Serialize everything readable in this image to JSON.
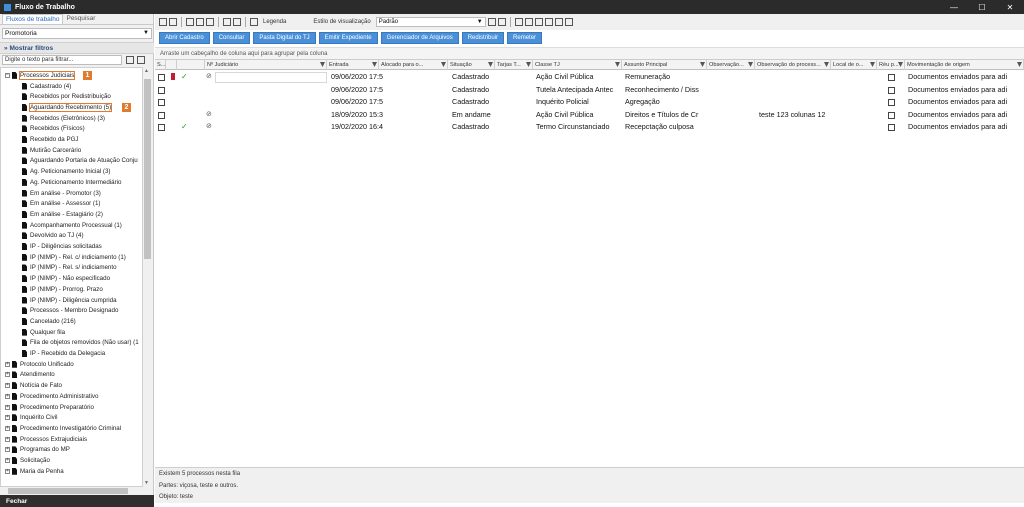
{
  "window": {
    "title": "Fluxo de Trabalho"
  },
  "left": {
    "tabs": [
      "Fluxos de trabalho",
      "Pesquisar"
    ],
    "combo_value": "Promotoria",
    "filter_toggle": "Mostrar filtros",
    "filter_placeholder": "Digite o texto para filtrar...",
    "tree": [
      {
        "label": "Processos Judiciais",
        "level": 1,
        "expanded": true,
        "highlight": 1
      },
      {
        "label": "Cadastrado (4)",
        "level": 2
      },
      {
        "label": "Recebidos por Redistribuição",
        "level": 2
      },
      {
        "label": "Aguardando Recebimento (5)",
        "level": 2,
        "highlight": 2
      },
      {
        "label": "Recebidos (Eletrônicos) (3)",
        "level": 2
      },
      {
        "label": "Recebidos (Físicos)",
        "level": 2
      },
      {
        "label": "Recebido da PGJ",
        "level": 2
      },
      {
        "label": "Mutirão Carcerário",
        "level": 2
      },
      {
        "label": "Aguardando Portaria de Atuação Conju",
        "level": 2
      },
      {
        "label": "Ag. Peticionamento Inicial (3)",
        "level": 2
      },
      {
        "label": "Ag. Peticionamento Intermediário",
        "level": 2
      },
      {
        "label": "Em análise - Promotor (3)",
        "level": 2
      },
      {
        "label": "Em análise - Assessor (1)",
        "level": 2
      },
      {
        "label": "Em análise - Estagiário (2)",
        "level": 2
      },
      {
        "label": "Acompanhamento Processual (1)",
        "level": 2
      },
      {
        "label": "Devolvido ao TJ (4)",
        "level": 2
      },
      {
        "label": "IP - Diligências solicitadas",
        "level": 2
      },
      {
        "label": "IP (NIMP) - Rel. c/ indiciamento (1)",
        "level": 2
      },
      {
        "label": "IP (NIMP) - Rel. s/ indiciamento",
        "level": 2
      },
      {
        "label": "IP (NIMP) - Não especificado",
        "level": 2
      },
      {
        "label": "IP (NIMP) - Prorrog. Prazo",
        "level": 2
      },
      {
        "label": "IP (NIMP) - Diligência cumprida",
        "level": 2
      },
      {
        "label": "Processos - Membro Designado",
        "level": 2
      },
      {
        "label": "Cancelado (216)",
        "level": 2
      },
      {
        "label": "Qualquer fila",
        "level": 2
      },
      {
        "label": "Fila de objetos removidos (Não usar) (1",
        "level": 2
      },
      {
        "label": "IP - Recebido da Delegacia",
        "level": 2
      },
      {
        "label": "Protocolo Unificado",
        "level": 1
      },
      {
        "label": "Atendimento",
        "level": 1
      },
      {
        "label": "Notícia de Fato",
        "level": 1
      },
      {
        "label": "Procedimento Administrativo",
        "level": 1
      },
      {
        "label": "Procedimento Preparatório",
        "level": 1
      },
      {
        "label": "Inquérito Civil",
        "level": 1
      },
      {
        "label": "Procedimento Investigatório Criminal",
        "level": 1
      },
      {
        "label": "Processos Extrajudiciais",
        "level": 1
      },
      {
        "label": "Programas do MP",
        "level": 1
      },
      {
        "label": "Solicitação",
        "level": 1
      },
      {
        "label": "Maria da Penha",
        "level": 1
      }
    ],
    "badges": [
      "1",
      "2"
    ],
    "close_label": "Fechar"
  },
  "toolbar": {
    "legend_label": "Legenda",
    "view_style_label": "Estilo de visualização",
    "view_style_value": "Padrão",
    "buttons": [
      "Abrir Cadastro",
      "Consultar",
      "Pasta Digital do TJ",
      "Emitir Expediente",
      "Gerenciador de Arquivos",
      "Redistribuir",
      "Remeter"
    ]
  },
  "grid": {
    "group_hint": "Arraste um cabeçalho de coluna aqui para agrupar pela coluna",
    "columns": [
      "S...",
      "",
      "",
      "Nº Judiciário",
      "Entrada",
      "Alocado para o...",
      "Situação",
      "Tarjas T...",
      "Classe TJ",
      "Assunto Principal",
      "Observação...",
      "Observação do process...",
      "Local de o...",
      "Réu p...",
      "Movimentação de origem"
    ],
    "rows": [
      {
        "flag": true,
        "check": true,
        "clip": true,
        "entrada": "09/06/2020 17:5",
        "situacao": "Cadastrado",
        "classe": "Ação Civil Pública",
        "assunto": "Remuneração",
        "obs_proc": "",
        "movimentacao": "Documentos enviados para adi"
      },
      {
        "flag": false,
        "check": false,
        "clip": false,
        "entrada": "09/06/2020 17:5",
        "situacao": "Cadastrado",
        "classe": "Tutela Antecipada Antec",
        "assunto": "Reconhecimento / Diss",
        "obs_proc": "",
        "movimentacao": "Documentos enviados para adi"
      },
      {
        "flag": false,
        "check": false,
        "clip": false,
        "entrada": "09/06/2020 17:5",
        "situacao": "Cadastrado",
        "classe": "Inquérito Policial",
        "assunto": "Agregação",
        "obs_proc": "",
        "movimentacao": "Documentos enviados para adi"
      },
      {
        "flag": false,
        "check": false,
        "clip": true,
        "entrada": "18/09/2020 15:3",
        "situacao": "Em andame",
        "classe": "Ação Civil Pública",
        "assunto": "Direitos e Títulos de Cr",
        "obs_proc": "teste 123  colunas 12",
        "movimentacao": "Documentos enviados para adi"
      },
      {
        "flag": false,
        "check": true,
        "clip": true,
        "entrada": "19/02/2020 16:4",
        "situacao": "Cadastrado",
        "classe": "Termo Circunstanciado",
        "assunto": "Recepctação culposa",
        "obs_proc": "",
        "movimentacao": "Documentos enviados para adi"
      }
    ]
  },
  "status": {
    "count": "Existem 5 processos nesta fila",
    "partes": "Partes: viçosa, teste e outros.",
    "objeto": "Objeto: teste"
  },
  "colors": {
    "accent": "#4a90d9",
    "highlight": "#e07a2e",
    "titlebar": "#2b2b2b"
  }
}
